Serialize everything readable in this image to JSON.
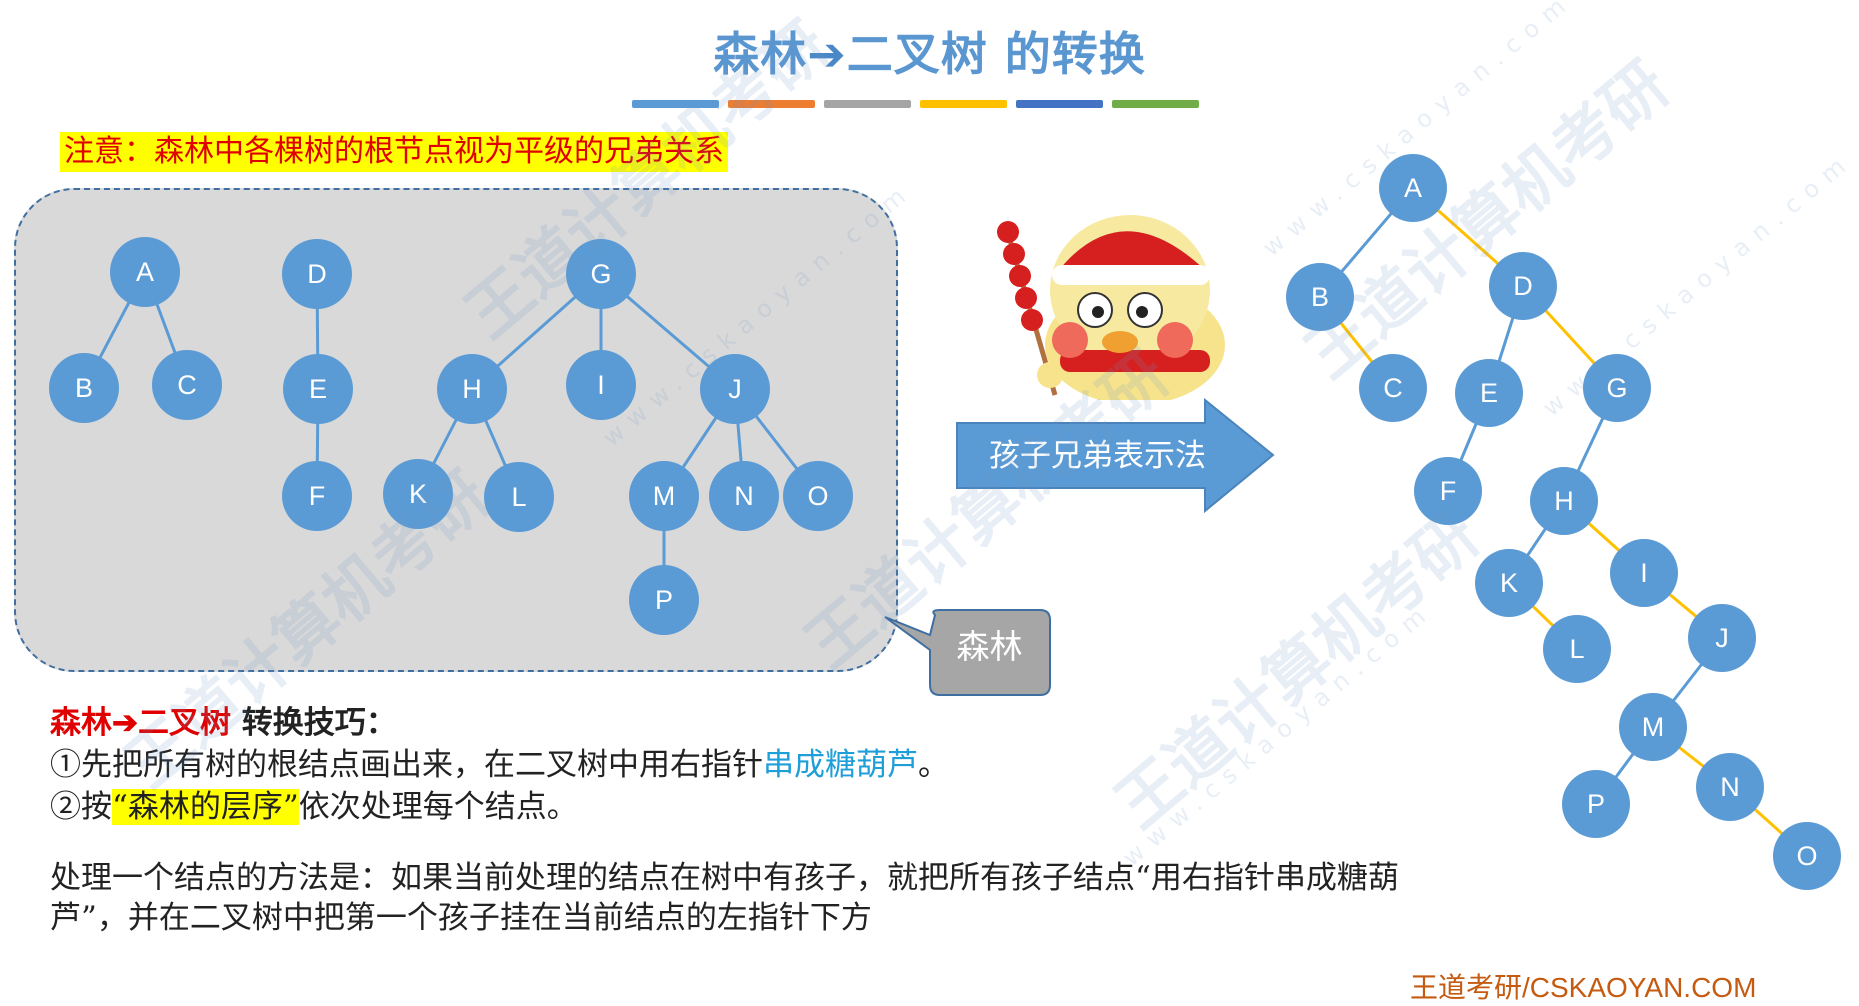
{
  "title": {
    "left": "森林",
    "arrow": "➔",
    "right": "二叉树 的转换"
  },
  "color_bars": [
    "#5b9bd5",
    "#ed7d31",
    "#a5a5a5",
    "#ffc000",
    "#4472c4",
    "#70ad47"
  ],
  "note": "注意：森林中各棵树的根节点视为平级的兄弟关系",
  "method_arrow_label": "孩子兄弟表示法",
  "forest_label": "森林",
  "colors": {
    "node": "#5b9bd5",
    "edge": "#5b9bd5",
    "right_edge": "#ffc000",
    "box": "#d9d9d9",
    "arrow": "#5b9bd5",
    "callout": "#a6a6a6"
  },
  "forest": {
    "nodes": [
      {
        "id": "A"
      },
      {
        "id": "B"
      },
      {
        "id": "C"
      },
      {
        "id": "D"
      },
      {
        "id": "E"
      },
      {
        "id": "F"
      },
      {
        "id": "G"
      },
      {
        "id": "H"
      },
      {
        "id": "I"
      },
      {
        "id": "J"
      },
      {
        "id": "K"
      },
      {
        "id": "L"
      },
      {
        "id": "M"
      },
      {
        "id": "N"
      },
      {
        "id": "O"
      },
      {
        "id": "P"
      }
    ],
    "edges": [
      [
        "A",
        "B"
      ],
      [
        "A",
        "C"
      ],
      [
        "D",
        "E"
      ],
      [
        "E",
        "F"
      ],
      [
        "G",
        "H"
      ],
      [
        "G",
        "I"
      ],
      [
        "G",
        "J"
      ],
      [
        "H",
        "K"
      ],
      [
        "H",
        "L"
      ],
      [
        "J",
        "M"
      ],
      [
        "J",
        "N"
      ],
      [
        "J",
        "O"
      ],
      [
        "M",
        "P"
      ]
    ]
  },
  "binary_tree": {
    "nodes": [
      {
        "id": "A"
      },
      {
        "id": "B"
      },
      {
        "id": "C"
      },
      {
        "id": "D"
      },
      {
        "id": "E"
      },
      {
        "id": "F"
      },
      {
        "id": "G"
      },
      {
        "id": "H"
      },
      {
        "id": "I"
      },
      {
        "id": "J"
      },
      {
        "id": "K"
      },
      {
        "id": "L"
      },
      {
        "id": "M"
      },
      {
        "id": "N"
      },
      {
        "id": "O"
      },
      {
        "id": "P"
      }
    ],
    "edges": [
      {
        "from": "A",
        "to": "B",
        "side": "left"
      },
      {
        "from": "A",
        "to": "D",
        "side": "right"
      },
      {
        "from": "B",
        "to": "C",
        "side": "right"
      },
      {
        "from": "D",
        "to": "E",
        "side": "left"
      },
      {
        "from": "D",
        "to": "G",
        "side": "right"
      },
      {
        "from": "E",
        "to": "F",
        "side": "left"
      },
      {
        "from": "G",
        "to": "H",
        "side": "left"
      },
      {
        "from": "H",
        "to": "K",
        "side": "left"
      },
      {
        "from": "H",
        "to": "I",
        "side": "right"
      },
      {
        "from": "K",
        "to": "L",
        "side": "right"
      },
      {
        "from": "I",
        "to": "J",
        "side": "right"
      },
      {
        "from": "J",
        "to": "M",
        "side": "left"
      },
      {
        "from": "M",
        "to": "P",
        "side": "left"
      },
      {
        "from": "M",
        "to": "N",
        "side": "right"
      },
      {
        "from": "N",
        "to": "O",
        "side": "right"
      }
    ]
  },
  "tips": {
    "heading_red": "森林➔二叉树",
    "heading_rest": " 转换技巧：",
    "step1_prefix": "①先把所有树的根结点画出来，在二叉树中用右指针",
    "step1_highlight": "串成糖葫芦",
    "step1_suffix": "。",
    "step2_prefix": "②按",
    "step2_highlight": "“森林的层序”",
    "step2_suffix": "依次处理每个结点。",
    "method": "处理一个结点的方法是：如果当前处理的结点在树中有孩子，就把所有孩子结点“用右指针串成糖葫芦”，并在二叉树中把第一个孩子挂在当前结点的左指针下方"
  },
  "watermark": {
    "brand": "王道计算机考研",
    "url": "www.cskaoyan.com"
  },
  "footer": "王道考研/CSKAOYAN.COM"
}
